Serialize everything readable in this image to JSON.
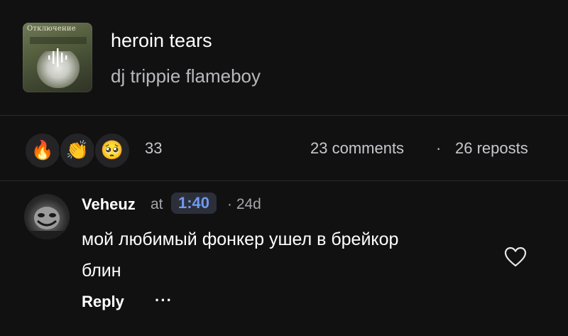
{
  "track": {
    "cover_label": "Отключение",
    "title": "heroin tears",
    "artist": "dj trippie flameboy"
  },
  "reactions": {
    "emojis": [
      {
        "icon": "fire-emoji",
        "glyph": "🔥"
      },
      {
        "icon": "clapping-hands-emoji",
        "glyph": "👏"
      },
      {
        "icon": "pleading-face-emoji",
        "glyph": "🥺"
      }
    ],
    "count": "33",
    "comments": "23 comments",
    "separator": "·",
    "reposts": "26 reposts"
  },
  "comment": {
    "username": "Veheuz",
    "at_word": "at",
    "timestamp": "1:40",
    "ago": "· 24d",
    "text": "мой любимый фонкер ушел в брейкор блин",
    "reply_label": "Reply",
    "more_label": "···"
  },
  "colors": {
    "background": "#111112",
    "timestamp_accent": "#6f9bf0",
    "muted_text": "#a6a6ab"
  }
}
